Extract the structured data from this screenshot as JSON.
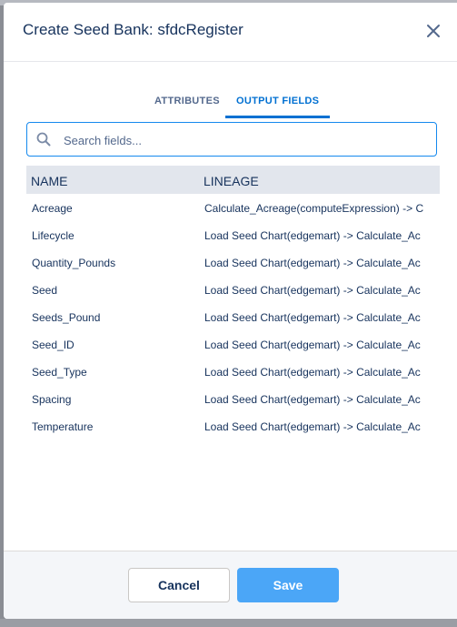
{
  "modal": {
    "title": "Create Seed Bank: sfdcRegister",
    "close_icon": "close-icon"
  },
  "tabs": [
    {
      "label": "ATTRIBUTES",
      "active": false
    },
    {
      "label": "OUTPUT FIELDS",
      "active": true
    }
  ],
  "search": {
    "placeholder": "Search fields...",
    "value": "",
    "icon": "search-icon"
  },
  "table": {
    "columns": [
      "NAME",
      "LINEAGE"
    ],
    "rows": [
      {
        "name": "Acreage",
        "lineage": "Calculate_Acreage(computeExpression) -> C"
      },
      {
        "name": "Lifecycle",
        "lineage": "Load Seed Chart(edgemart) -> Calculate_Ac"
      },
      {
        "name": "Quantity_Pounds",
        "lineage": "Load Seed Chart(edgemart) -> Calculate_Ac"
      },
      {
        "name": "Seed",
        "lineage": "Load Seed Chart(edgemart) -> Calculate_Ac"
      },
      {
        "name": "Seeds_Pound",
        "lineage": "Load Seed Chart(edgemart) -> Calculate_Ac"
      },
      {
        "name": "Seed_ID",
        "lineage": "Load Seed Chart(edgemart) -> Calculate_Ac"
      },
      {
        "name": "Seed_Type",
        "lineage": "Load Seed Chart(edgemart) -> Calculate_Ac"
      },
      {
        "name": "Spacing",
        "lineage": "Load Seed Chart(edgemart) -> Calculate_Ac"
      },
      {
        "name": "Temperature",
        "lineage": "Load Seed Chart(edgemart) -> Calculate_Ac"
      }
    ]
  },
  "footer": {
    "cancel_label": "Cancel",
    "save_label": "Save"
  },
  "colors": {
    "brand": "#0070d2",
    "save_button": "#4ba6f7",
    "header_row": "#e2e6ed",
    "text": "#16325c"
  }
}
